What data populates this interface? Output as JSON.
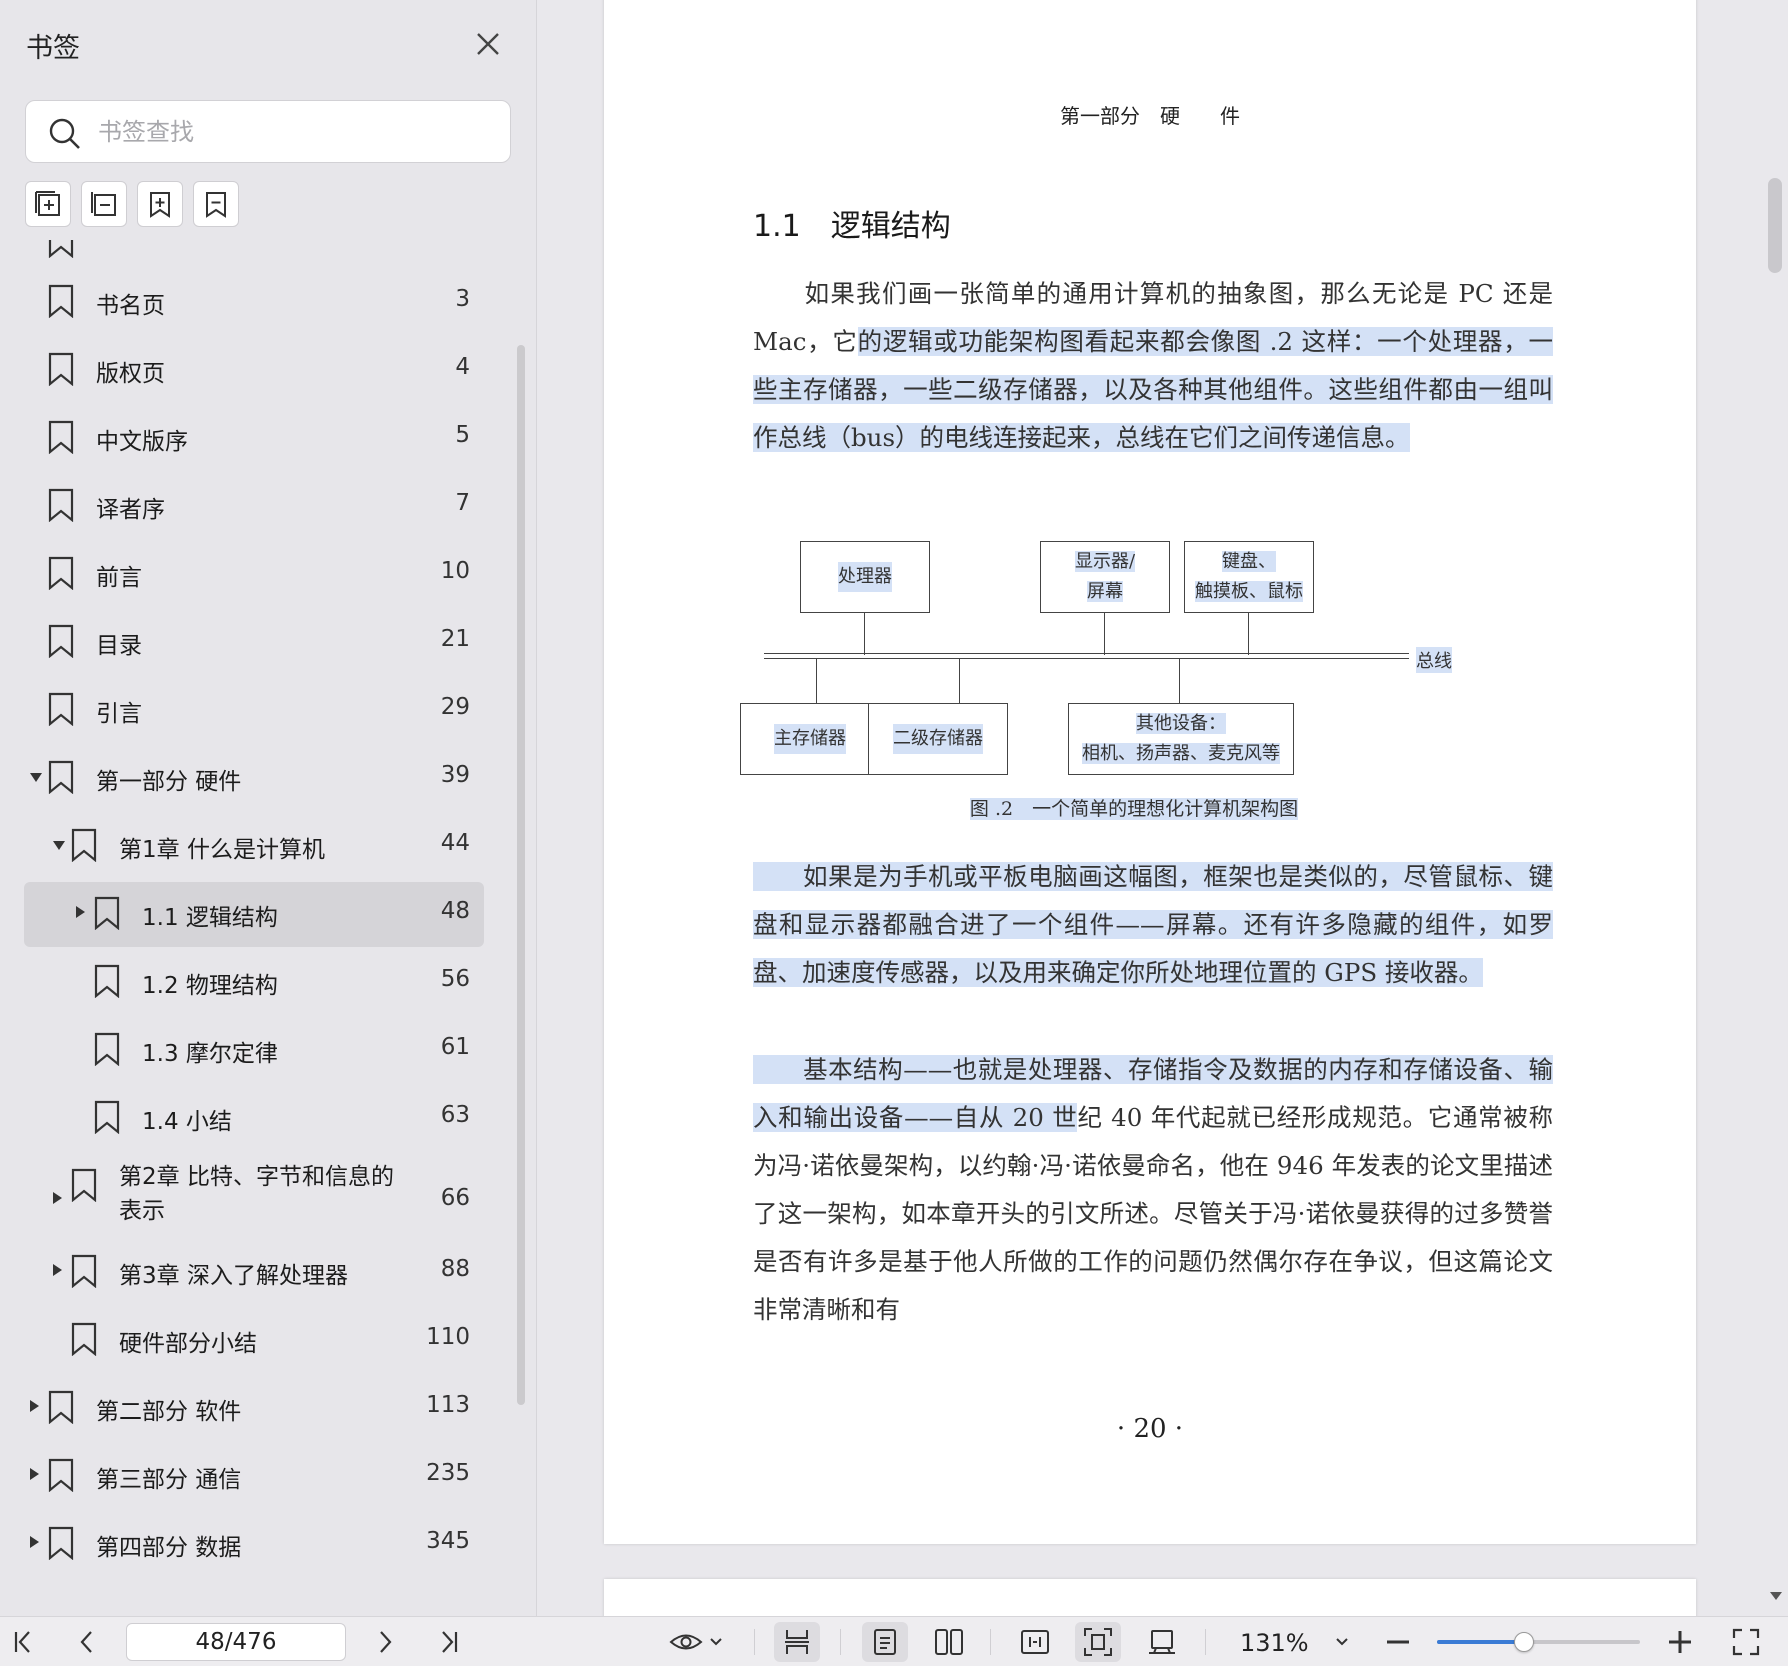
{
  "sidebar": {
    "title": "书签",
    "search_placeholder": "书签查找",
    "bookmarks": [
      {
        "label": "书名页",
        "page": "3",
        "level": 0,
        "caret": "none",
        "selected": false
      },
      {
        "label": "版权页",
        "page": "4",
        "level": 0,
        "caret": "none",
        "selected": false
      },
      {
        "label": "中文版序",
        "page": "5",
        "level": 0,
        "caret": "none",
        "selected": false
      },
      {
        "label": "译者序",
        "page": "7",
        "level": 0,
        "caret": "none",
        "selected": false
      },
      {
        "label": "前言",
        "page": "10",
        "level": 0,
        "caret": "none",
        "selected": false
      },
      {
        "label": "目录",
        "page": "21",
        "level": 0,
        "caret": "none",
        "selected": false
      },
      {
        "label": "引言",
        "page": "29",
        "level": 0,
        "caret": "none",
        "selected": false
      },
      {
        "label": "第一部分 硬件",
        "page": "39",
        "level": 0,
        "caret": "open",
        "selected": false
      },
      {
        "label": "第1章 什么是计算机",
        "page": "44",
        "level": 1,
        "caret": "open",
        "selected": false
      },
      {
        "label": "1.1 逻辑结构",
        "page": "48",
        "level": 2,
        "caret": "closed",
        "selected": true
      },
      {
        "label": "1.2 物理结构",
        "page": "56",
        "level": 2,
        "caret": "none",
        "selected": false
      },
      {
        "label": "1.3 摩尔定律",
        "page": "61",
        "level": 2,
        "caret": "none",
        "selected": false
      },
      {
        "label": "1.4 小结",
        "page": "63",
        "level": 2,
        "caret": "none",
        "selected": false
      },
      {
        "label": "第2章 比特、字节和信息的",
        "label2": "表示",
        "page": "66",
        "level": 1,
        "caret": "closed",
        "selected": false
      },
      {
        "label": "第3章 深入了解处理器",
        "page": "88",
        "level": 1,
        "caret": "closed",
        "selected": false
      },
      {
        "label": "硬件部分小结",
        "page": "110",
        "level": 1,
        "caret": "none",
        "selected": false
      },
      {
        "label": "第二部分 软件",
        "page": "113",
        "level": 0,
        "caret": "closed",
        "selected": false
      },
      {
        "label": "第三部分 通信",
        "page": "235",
        "level": 0,
        "caret": "closed",
        "selected": false
      },
      {
        "label": "第四部分 数据",
        "page": "345",
        "level": 0,
        "caret": "closed",
        "selected": false
      }
    ]
  },
  "document": {
    "header": "第一部分　硬　　件",
    "heading_num": "1.1",
    "heading_title": "逻辑结构",
    "para1_plain": "　　如果我们画一张简单的通用计算机的抽象图，那么无论是 PC 还是 Mac，它",
    "para1_hl": "的逻辑或功能架构图看起来都会像图 .2 这样：一个处理器，一些主存储器，一些二级存储器，以及各种其他组件。这些组件都由一组叫作总线（bus）的电线连接起来，总线在它们之间传递信息。",
    "diagram": {
      "processor": "处理器",
      "display_1": "显示器/",
      "display_2": "屏幕",
      "keyboard_1": "键盘、",
      "keyboard_2": "触摸板、鼠标",
      "bus": "总线",
      "main_mem": "主存储器",
      "secondary": "二级存储器",
      "other_1": "其他设备：",
      "other_2": "相机、扬声器、麦克风等",
      "caption": "图 .2　一个简单的理想化计算机架构图"
    },
    "para2_hl": "　　如果是为手机或平板电脑画这幅图，框架也是类似的，尽管鼠标、键盘和显示器都融合进了一个组件——屏幕。还有许多隐藏的组件，如罗盘、加速度传感器，以及用来确定你所处地理位置的 GPS 接收器。",
    "para3_hl": "　　基本结构——也就是处理器、存储指令及数据的内存和存储设备、输入和输出设备——自从 20 世",
    "para3_plain": "纪 40 年代起就已经形成规范。它通常被称为冯·诺依曼架构，以约翰·冯·诺依曼命名，他在 946 年发表的论文里描述了这一架构，如本章开头的引文所述。尽管关于冯·诺依曼获得的过多赞誉是否有许多是基于他人所做的工作的问题仍然偶尔存在争议，但这篇论文非常清晰和有",
    "footer": "· 20 ·"
  },
  "bottombar": {
    "page_value": "48/476",
    "zoom": "131%",
    "zoom_fraction": 0.43
  },
  "colors": {
    "highlight": "#d4e1f6",
    "accent": "#3a7bd5"
  }
}
